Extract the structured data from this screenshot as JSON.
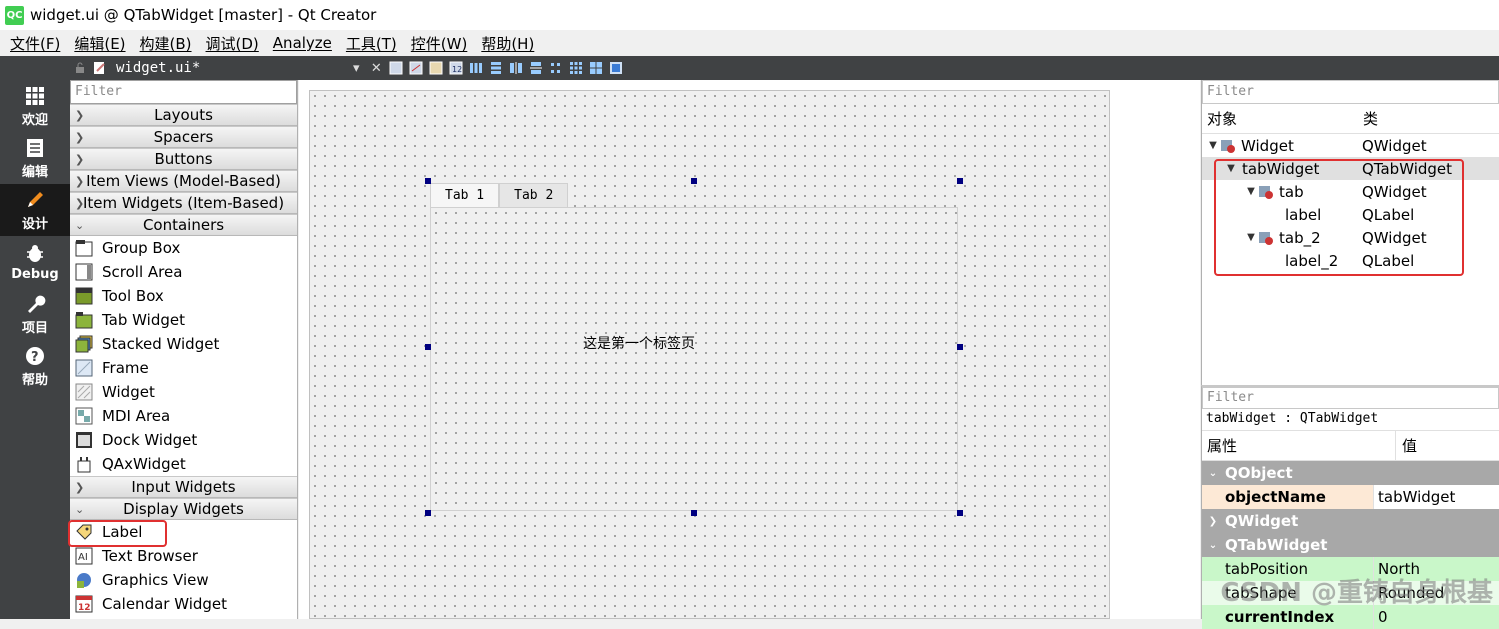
{
  "window": {
    "title": "widget.ui @ QTabWidget [master] - Qt Creator",
    "logo": "QC"
  },
  "menu": [
    "文件(F)",
    "编辑(E)",
    "构建(B)",
    "调试(D)",
    "Analyze",
    "工具(T)",
    "控件(W)",
    "帮助(H)"
  ],
  "modes": [
    {
      "label": "欢迎",
      "icon": "grid-icon"
    },
    {
      "label": "编辑",
      "icon": "document-icon"
    },
    {
      "label": "设计",
      "icon": "pencil-icon"
    },
    {
      "label": "Debug",
      "icon": "bug-icon"
    },
    {
      "label": "项目",
      "icon": "wrench-icon"
    },
    {
      "label": "帮助",
      "icon": "help-icon"
    }
  ],
  "editor": {
    "file_name": "widget.ui*",
    "close_glyph": "✕"
  },
  "widgetbox": {
    "filter_placeholder": "Filter",
    "categories": {
      "layouts": "Layouts",
      "spacers": "Spacers",
      "buttons": "Buttons",
      "item_views": "Item Views (Model-Based)",
      "item_widgets": "Item Widgets (Item-Based)",
      "containers": "Containers",
      "input_widgets": "Input Widgets",
      "display_widgets": "Display Widgets"
    },
    "containers": [
      "Group Box",
      "Scroll Area",
      "Tool Box",
      "Tab Widget",
      "Stacked Widget",
      "Frame",
      "Widget",
      "MDI Area",
      "Dock Widget",
      "QAxWidget"
    ],
    "display": [
      "Label",
      "Text Browser",
      "Graphics View",
      "Calendar Widget"
    ]
  },
  "form": {
    "tabs": [
      "Tab 1",
      "Tab 2"
    ],
    "page_label": "这是第一个标签页"
  },
  "object_inspector": {
    "filter_placeholder": "Filter",
    "col_object": "对象",
    "col_class": "类",
    "rows": [
      {
        "name": "Widget",
        "cls": "QWidget"
      },
      {
        "name": "tabWidget",
        "cls": "QTabWidget"
      },
      {
        "name": "tab",
        "cls": "QWidget"
      },
      {
        "name": "label",
        "cls": "QLabel"
      },
      {
        "name": "tab_2",
        "cls": "QWidget"
      },
      {
        "name": "label_2",
        "cls": "QLabel"
      }
    ]
  },
  "property_editor": {
    "filter_placeholder": "Filter",
    "class_line": "tabWidget : QTabWidget",
    "col_property": "属性",
    "col_value": "值",
    "group_qobject": "QObject",
    "objectname_key": "objectName",
    "objectname_val": "tabWidget",
    "group_qwidget": "QWidget",
    "group_qtabwidget": "QTabWidget",
    "tabposition_key": "tabPosition",
    "tabposition_val": "North",
    "tabshape_key": "tabShape",
    "tabshape_val": "Rounded",
    "currentindex_key": "currentIndex",
    "currentindex_val": "0"
  },
  "watermark": "CSDN @重铸自身根基",
  "colors": {
    "highlight_red": "#e03030",
    "prop_key_bg": "#fde9d6",
    "prop_green": "#c9f7c9",
    "handle": "#000080"
  }
}
